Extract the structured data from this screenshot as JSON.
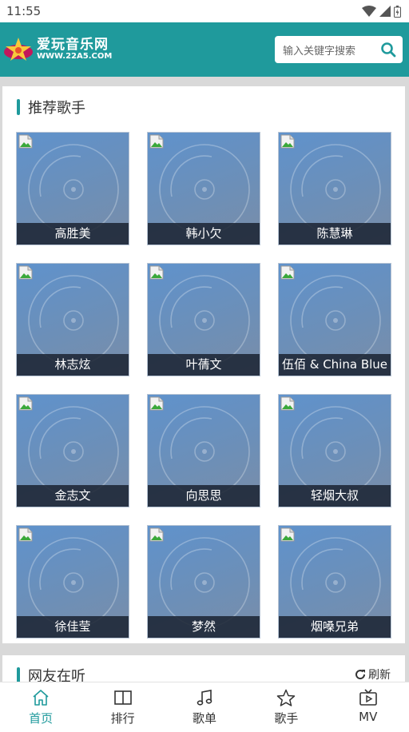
{
  "status_bar": {
    "time": "11:55"
  },
  "header": {
    "logo_cn": "爱玩音乐网",
    "logo_en": "WWW.22A5.COM",
    "search_placeholder": "输入关键字搜索"
  },
  "recommended": {
    "title": "推荐歌手",
    "artists": [
      {
        "name": "高胜美"
      },
      {
        "name": "韩小欠"
      },
      {
        "name": "陈慧琳"
      },
      {
        "name": "林志炫"
      },
      {
        "name": "叶蒨文"
      },
      {
        "name": "伍佰 & China Blue"
      },
      {
        "name": "金志文"
      },
      {
        "name": "向思思"
      },
      {
        "name": "轻烟大叔"
      },
      {
        "name": "徐佳莹"
      },
      {
        "name": "梦然"
      },
      {
        "name": "烟嗓兄弟"
      }
    ]
  },
  "listening": {
    "title": "网友在听",
    "refresh_label": "刷新"
  },
  "bottom_nav": {
    "items": [
      {
        "label": "首页",
        "icon": "home-icon",
        "active": true
      },
      {
        "label": "排行",
        "icon": "book-icon",
        "active": false
      },
      {
        "label": "歌单",
        "icon": "music-note-icon",
        "active": false
      },
      {
        "label": "歌手",
        "icon": "star-icon",
        "active": false
      },
      {
        "label": "MV",
        "icon": "tv-icon",
        "active": false
      }
    ]
  },
  "colors": {
    "accent": "#1f9a9c"
  }
}
